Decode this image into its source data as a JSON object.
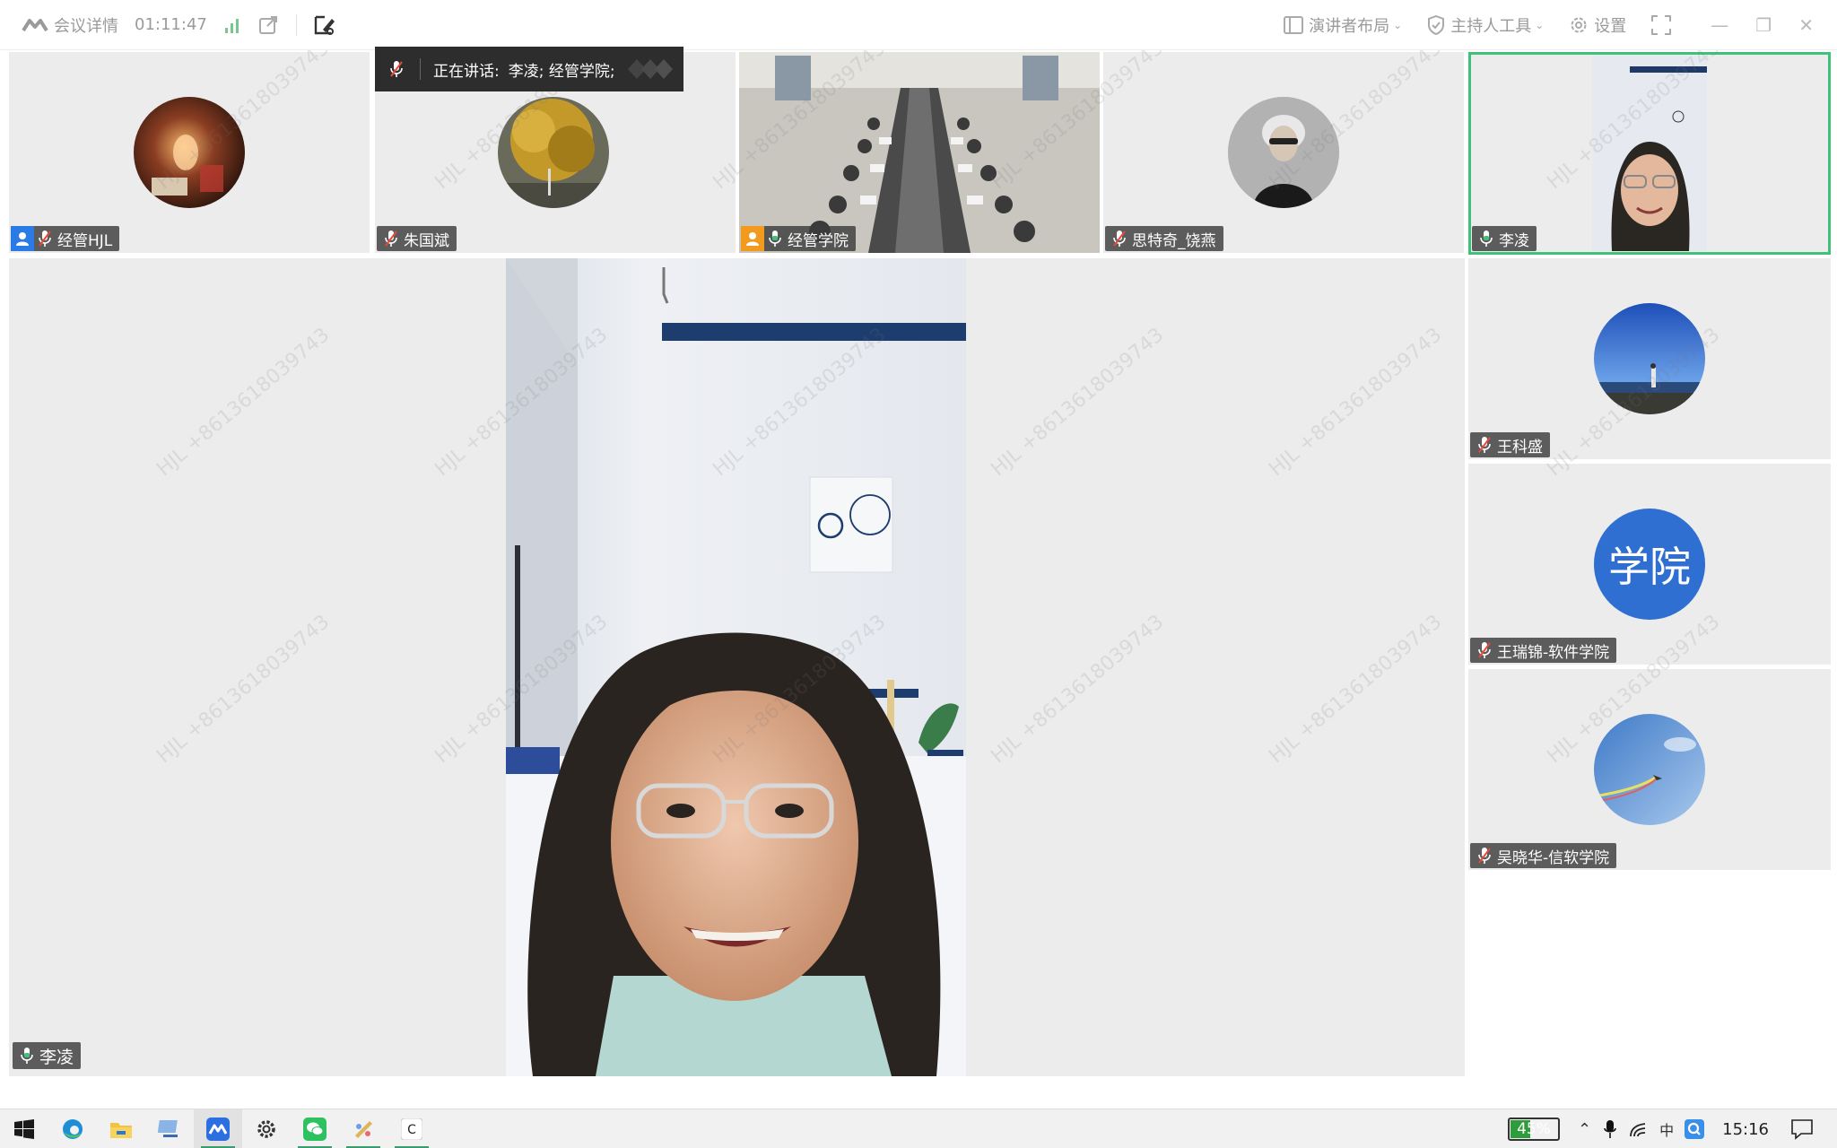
{
  "topbar": {
    "meeting_details": "会议详情",
    "timer": "01:11:47",
    "speaker_layout": "演讲者布局",
    "host_tools": "主持人工具",
    "settings": "设置"
  },
  "speaking_banner": {
    "label": "正在讲话:",
    "names": "李凌; 经管学院;"
  },
  "participants": [
    {
      "name": "经管HJL",
      "role_badge": "host",
      "mic": "muted"
    },
    {
      "name": "朱国斌",
      "mic": "muted"
    },
    {
      "name": "经管学院",
      "role_badge": "cohost",
      "mic": "on"
    },
    {
      "name": "思特奇_饶燕",
      "mic": "muted"
    },
    {
      "name": "李凌",
      "mic": "on",
      "active_speaker": true
    },
    {
      "name": "王科盛",
      "mic": "muted"
    },
    {
      "name": "王瑞锦-软件学院",
      "mic": "muted",
      "avatar_text": "学院"
    },
    {
      "name": "吴晓华-信软学院",
      "mic": "muted"
    }
  ],
  "main_video": {
    "name": "李凌"
  },
  "watermark": "HJL +8613618039743",
  "taskbar": {
    "battery": "45%",
    "battery_level": 0.45,
    "clock": "15:16"
  },
  "colors": {
    "active_border": "#3ec27a",
    "host_badge": "#2b7be6",
    "cohost_badge": "#f29a1e",
    "muted_red": "#e64a3b"
  }
}
